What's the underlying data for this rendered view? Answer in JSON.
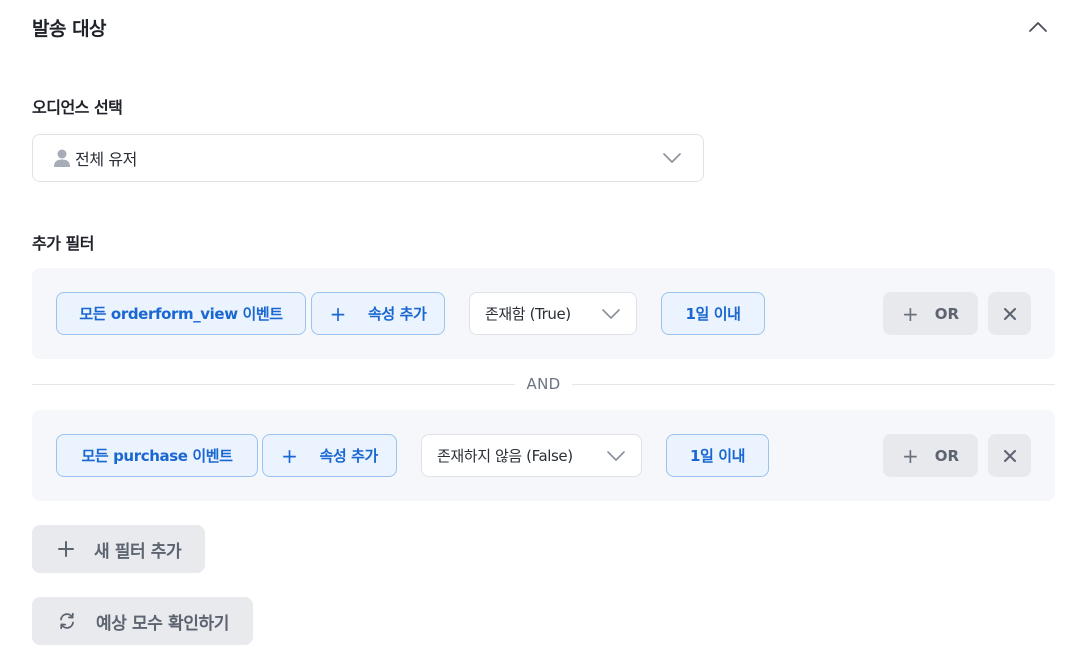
{
  "section": {
    "title": "발송 대상",
    "collapse_icon": "chevron-up-icon"
  },
  "audience": {
    "label": "오디언스 선택",
    "selected_value": "전체 유저",
    "icon": "user-icon"
  },
  "filters": {
    "label": "추가 필터",
    "connector": "AND",
    "items": [
      {
        "event_label": "모든 orderform_view 이벤트",
        "add_property_label": "속성 추가",
        "condition": "존재함 (True)",
        "period": "1일 이내",
        "or_label": "OR"
      },
      {
        "event_label": "모든 purchase 이벤트",
        "add_property_label": "속성 추가",
        "condition": "존재하지 않음 (False)",
        "period": "1일 이내",
        "or_label": "OR"
      }
    ]
  },
  "actions": {
    "add_filter_label": "새 필터 추가",
    "estimate_label": "예상 모수 확인하기"
  },
  "colors": {
    "accent": "#1a67d2",
    "chip_bg": "#eaf3fe",
    "chip_border": "#9cc3f0",
    "filter_bg": "#f5f7fa",
    "button_gray": "#e8eaee"
  }
}
